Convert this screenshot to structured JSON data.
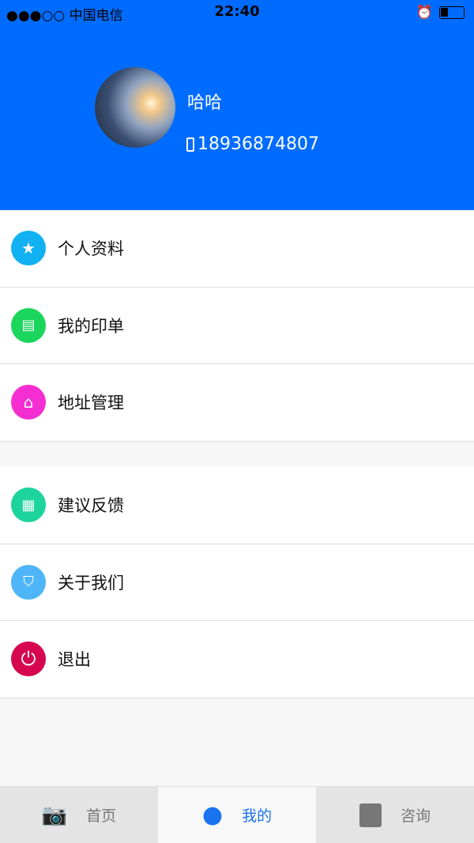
{
  "status_bar": {
    "carrier": "●●●○○ 中国电信",
    "time": "22:40"
  },
  "profile": {
    "name": "哈哈",
    "phone": "18936874807"
  },
  "menu_groups": [
    [
      {
        "label": "个人资料",
        "icon": "star-icon",
        "color": "#11b1f2"
      },
      {
        "label": "我的印单",
        "icon": "list-icon",
        "color": "#1ad65c"
      },
      {
        "label": "地址管理",
        "icon": "home-icon",
        "color": "#f52ed2"
      }
    ],
    [
      {
        "label": "建议反馈",
        "icon": "newspaper-icon",
        "color": "#1dd49c"
      },
      {
        "label": "关于我们",
        "icon": "bookmark-icon",
        "color": "#4fb5f9"
      },
      {
        "label": "退出",
        "icon": "power-icon",
        "color": "#d6064f"
      }
    ]
  ],
  "tabs": [
    {
      "label": "首页",
      "icon": "camera-icon"
    },
    {
      "label": "我的",
      "icon": "user-icon",
      "active": true
    },
    {
      "label": "咨询",
      "icon": "chat-icon"
    }
  ]
}
